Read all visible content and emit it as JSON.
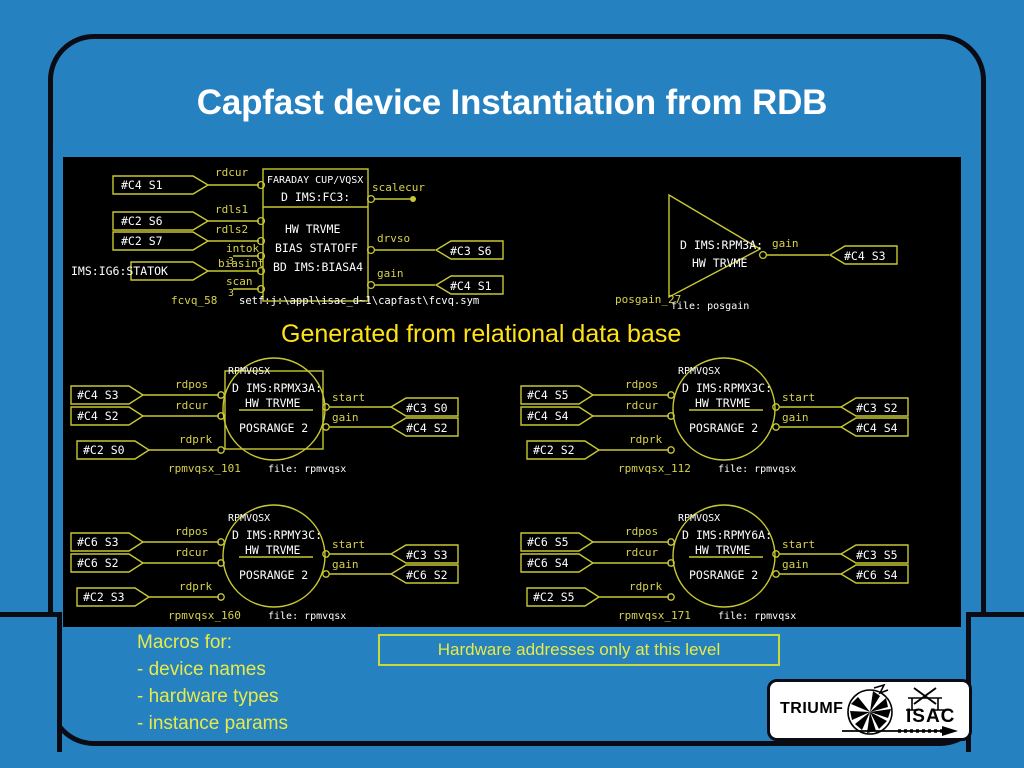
{
  "slide": {
    "title": "Capfast device Instantiation from RDB",
    "background_color": "#2581bf",
    "border_color": "#0b0b14",
    "canvas_color": "#000000",
    "schematic_wire_color": "#c8c832",
    "schematic_text_color": "#ffffff",
    "label_text_color": "#d7d24b",
    "caption_color": "#ffe215",
    "note_color": "#e8ea4a"
  },
  "caption": {
    "generated": "Generated from relational data base"
  },
  "notes": {
    "macros_header": "Macros for:",
    "macros_items": [
      "- device names",
      "- hardware types",
      "- instance params"
    ],
    "hardware_callout": "Hardware addresses only at this level"
  },
  "logo": {
    "triumf": "TRIUMF",
    "isac": "ISAC"
  },
  "schematic": {
    "faraday_cup": {
      "title": "FARADAY CUP/VQSX",
      "device": "D IMS:FC3:",
      "hw": "HW TRVME",
      "bias": "BIAS STATOFF",
      "bd": "BD IMS:BIASA4",
      "instance": "fcvq_58",
      "setf": "setf:j:\\appl\\isac_d~1\\capfast\\fcvq.sym",
      "inputs": [
        {
          "pin": "rdcur",
          "addr": "#C4 S1"
        },
        {
          "pin": "rdls1",
          "addr": "#C2 S6"
        },
        {
          "pin": "rdls2",
          "addr": "#C2 S7"
        },
        {
          "pin": "intok",
          "addr": ""
        },
        {
          "pin": "biasint",
          "addr": "IMS:IG6:STATOK"
        },
        {
          "pin": "scan",
          "addr": ""
        }
      ],
      "outputs": [
        {
          "pin": "scalecur",
          "addr": ""
        },
        {
          "pin": "drvso",
          "addr": "#C3 S6"
        },
        {
          "pin": "gain",
          "addr": "#C4 S1"
        }
      ]
    },
    "posgain": {
      "device": "D IMS:RPM3A:",
      "hw": "HW TRVME",
      "instance": "posgain_27",
      "file": "file: posgain",
      "output_pin": "gain",
      "output_addr": "#C4 S3"
    },
    "rpm_blocks": [
      {
        "title": "RPMVQSX",
        "device": "D IMS:RPMX3A:",
        "hw": "HW TRVME",
        "param": "POSRANGE 2",
        "instance": "rpmvqsx_101",
        "file": "file: rpmvqsx",
        "inputs": [
          {
            "pin": "rdpos",
            "addr": "#C4 S3"
          },
          {
            "pin": "rdcur",
            "addr": "#C4 S2"
          },
          {
            "pin": "rdprk",
            "addr": "#C2 S0"
          }
        ],
        "outputs": [
          {
            "pin": "start",
            "addr": "#C3 S0"
          },
          {
            "pin": "gain",
            "addr": "#C4 S2"
          }
        ]
      },
      {
        "title": "RPMVQSX",
        "device": "D IMS:RPMX3C:",
        "hw": "HW TRVME",
        "param": "POSRANGE 2",
        "instance": "rpmvqsx_112",
        "file": "file: rpmvqsx",
        "inputs": [
          {
            "pin": "rdpos",
            "addr": "#C4 S5"
          },
          {
            "pin": "rdcur",
            "addr": "#C4 S4"
          },
          {
            "pin": "rdprk",
            "addr": "#C2 S2"
          }
        ],
        "outputs": [
          {
            "pin": "start",
            "addr": "#C3 S2"
          },
          {
            "pin": "gain",
            "addr": "#C4 S4"
          }
        ]
      },
      {
        "title": "RPMVQSX",
        "device": "D IMS:RPMY3C:",
        "hw": "HW TRVME",
        "param": "POSRANGE 2",
        "instance": "rpmvqsx_160",
        "file": "file: rpmvqsx",
        "inputs": [
          {
            "pin": "rdpos",
            "addr": "#C6 S3"
          },
          {
            "pin": "rdcur",
            "addr": "#C6 S2"
          },
          {
            "pin": "rdprk",
            "addr": "#C2 S3"
          }
        ],
        "outputs": [
          {
            "pin": "start",
            "addr": "#C3 S3"
          },
          {
            "pin": "gain",
            "addr": "#C6 S2"
          }
        ]
      },
      {
        "title": "RPMVQSX",
        "device": "D IMS:RPMY6A:",
        "hw": "HW TRVME",
        "param": "POSRANGE 2",
        "instance": "rpmvqsx_171",
        "file": "file: rpmvqsx",
        "inputs": [
          {
            "pin": "rdpos",
            "addr": "#C6 S5"
          },
          {
            "pin": "rdcur",
            "addr": "#C6 S4"
          },
          {
            "pin": "rdprk",
            "addr": "#C2 S5"
          }
        ],
        "outputs": [
          {
            "pin": "start",
            "addr": "#C3 S5"
          },
          {
            "pin": "gain",
            "addr": "#C6 S4"
          }
        ]
      }
    ]
  }
}
